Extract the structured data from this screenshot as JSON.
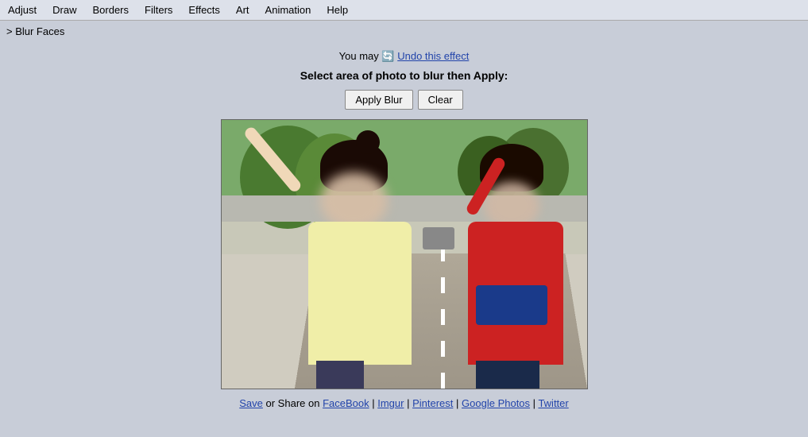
{
  "menubar": {
    "items": [
      "Adjust",
      "Draw",
      "Borders",
      "Filters",
      "Effects",
      "Art",
      "Animation",
      "Help"
    ]
  },
  "breadcrumb": {
    "text": "> Blur Faces"
  },
  "main": {
    "undo_prefix": "You may ",
    "undo_icon": "↩",
    "undo_link": "Undo this effect",
    "instruction": "Select area of photo to blur then Apply:",
    "apply_button": "Apply Blur",
    "clear_button": "Clear"
  },
  "footer": {
    "save_label": "Save",
    "or_share": " or Share on ",
    "facebook": "FaceBook",
    "separator1": " | ",
    "imgur": "Imgur",
    "separator2": " | ",
    "pinterest": "Pinterest",
    "separator3": " | ",
    "googlephotos": "Google Photos",
    "separator4": " | ",
    "twitter": "Twitter"
  }
}
